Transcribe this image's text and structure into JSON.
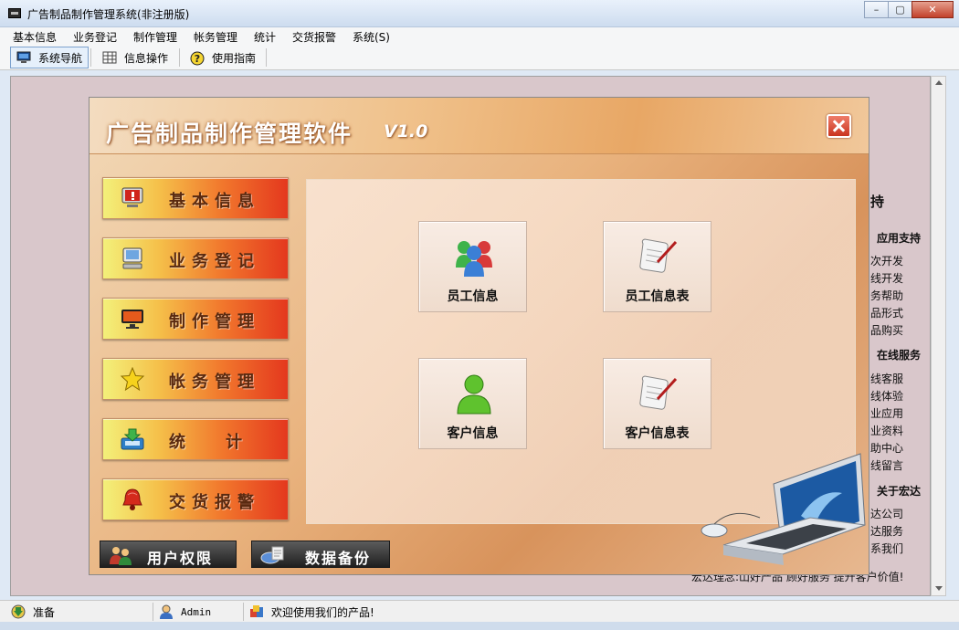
{
  "window": {
    "title": "广告制品制作管理系统(非注册版)",
    "controls": [
      "–",
      "▢",
      "✕"
    ]
  },
  "menubar": {
    "items": [
      "基本信息",
      "业务登记",
      "制作管理",
      "帐务管理",
      "统计",
      "交货报警",
      "系统(S)"
    ]
  },
  "toolbar": {
    "buttons": [
      {
        "label": "系统导航",
        "icon": "monitor-icon",
        "active": true
      },
      {
        "label": "信息操作",
        "icon": "grid-icon",
        "active": false
      },
      {
        "label": "使用指南",
        "icon": "help-icon",
        "active": false
      }
    ]
  },
  "background_page": {
    "fragments": [
      {
        "text": "持",
        "head": true
      },
      {
        "text": "应用支持",
        "head": true
      },
      {
        "text": "次开发",
        "head": false
      },
      {
        "text": "线开发",
        "head": false
      },
      {
        "text": "务帮助",
        "head": false
      },
      {
        "text": "品形式",
        "head": false
      },
      {
        "text": "品购买",
        "head": false
      },
      {
        "text": "在线服务",
        "head": true
      },
      {
        "text": "线客服",
        "head": false
      },
      {
        "text": "线体验",
        "head": false
      },
      {
        "text": "业应用",
        "head": false
      },
      {
        "text": "业资料",
        "head": false
      },
      {
        "text": "助中心",
        "head": false
      },
      {
        "text": "线留言",
        "head": false
      },
      {
        "text": "关于宏达",
        "head": true
      },
      {
        "text": "达公司",
        "head": false
      },
      {
        "text": "达服务",
        "head": false
      },
      {
        "text": "系我们",
        "head": false
      }
    ],
    "footer_text": "宏达理念:山好产品 顾好服务 提升客户价值!"
  },
  "dialog": {
    "title": "广告制品制作管理软件",
    "version": "V1.0",
    "nav_buttons": [
      {
        "label": "基本信息",
        "icon": "alert-monitor-icon"
      },
      {
        "label": "业务登记",
        "icon": "computer-icon"
      },
      {
        "label": "制作管理",
        "icon": "display-icon"
      },
      {
        "label": "帐务管理",
        "icon": "star-icon"
      },
      {
        "label": "统计",
        "icon": "download-tray-icon"
      },
      {
        "label": "交货报警",
        "icon": "alarm-bell-icon"
      }
    ],
    "tiles": [
      {
        "label": "员工信息",
        "icon": "users-group-icon"
      },
      {
        "label": "员工信息表",
        "icon": "scroll-pen-icon"
      },
      {
        "label": "客户信息",
        "icon": "user-green-icon"
      },
      {
        "label": "客户信息表",
        "icon": "scroll-pen-icon"
      }
    ],
    "bottom_buttons": [
      {
        "label": "用户权限",
        "icon": "users-permission-icon"
      },
      {
        "label": "数据备份",
        "icon": "backup-icon"
      }
    ]
  },
  "statusbar": {
    "ready": "准备",
    "user": "Admin",
    "message": "欢迎使用我们的产品!"
  },
  "colors": {
    "dialog_accent": "#e8a765",
    "nav_gradient_start": "#f3f07a",
    "nav_gradient_end": "#e4381e",
    "close_red": "#c9341f",
    "page_bg": "#d9c7cb"
  }
}
